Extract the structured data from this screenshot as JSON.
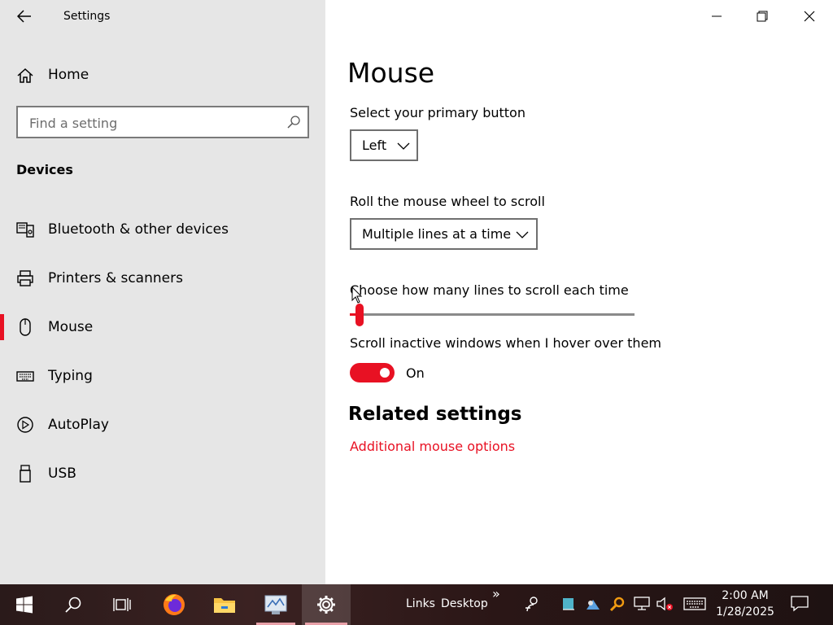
{
  "window": {
    "app_title": "Settings"
  },
  "sidebar": {
    "home_label": "Home",
    "search_placeholder": "Find a setting",
    "section_title": "Devices",
    "items": [
      {
        "label": "Bluetooth & other devices",
        "icon": "bluetooth-devices-icon"
      },
      {
        "label": "Printers & scanners",
        "icon": "printer-icon"
      },
      {
        "label": "Mouse",
        "icon": "mouse-icon",
        "selected": true
      },
      {
        "label": "Typing",
        "icon": "keyboard-icon"
      },
      {
        "label": "AutoPlay",
        "icon": "autoplay-icon"
      },
      {
        "label": "USB",
        "icon": "usb-icon"
      }
    ]
  },
  "main": {
    "title": "Mouse",
    "primary_button": {
      "label": "Select your primary button",
      "value": "Left"
    },
    "wheel_scroll": {
      "label": "Roll the mouse wheel to scroll",
      "value": "Multiple lines at a time"
    },
    "lines_slider": {
      "label": "Choose how many lines to scroll each time",
      "fill_fraction": 0.03
    },
    "inactive_scroll": {
      "label": "Scroll inactive windows when I hover over them",
      "state": "On"
    },
    "related": {
      "title": "Related settings",
      "link": "Additional mouse options"
    }
  },
  "taskbar": {
    "toolbar_links": "Links",
    "toolbar_desktop": "Desktop",
    "overflow": "»",
    "time": "2:00 AM",
    "date": "1/28/2025"
  },
  "colors": {
    "accent": "#e81123",
    "sidebar_bg": "#e6e6e6"
  }
}
